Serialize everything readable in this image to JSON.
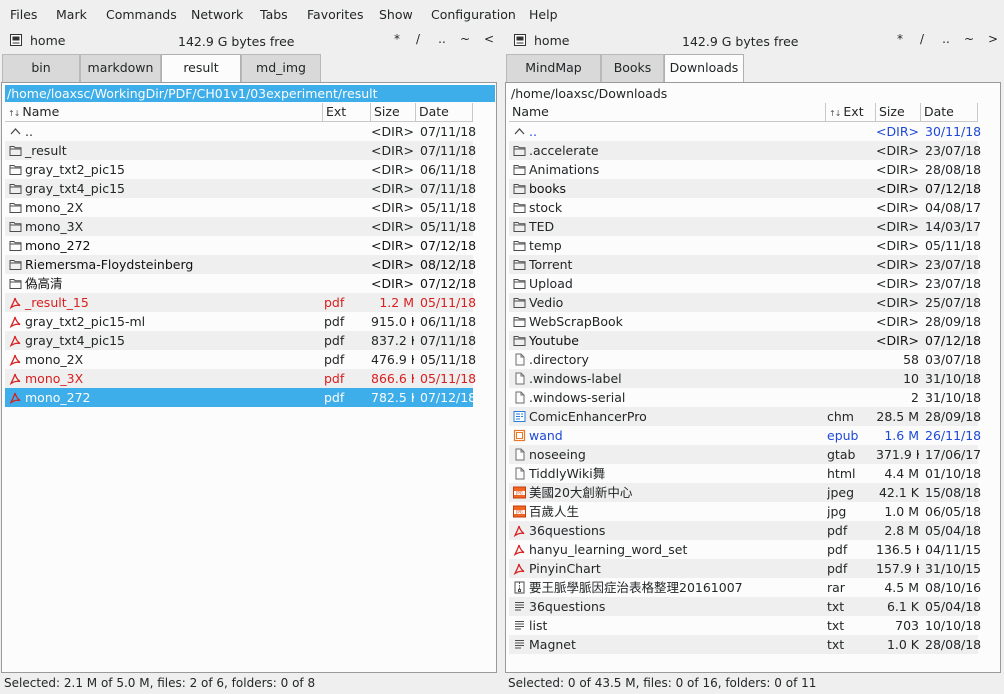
{
  "menu": [
    "Files",
    "Mark",
    "Commands",
    "Network",
    "Tabs",
    "Favorites",
    "Show",
    "Configuration",
    "Help"
  ],
  "left": {
    "drive": "home",
    "free": "142.9 G bytes free",
    "nav": [
      "*",
      "/",
      "..",
      "~",
      "<"
    ],
    "tabs": [
      "bin",
      "markdown",
      "result",
      "md_img"
    ],
    "active_tab": 2,
    "path": "/home/loaxsc/WorkingDir/PDF/CH01v1/03experiment/result",
    "headers": {
      "name": "Name",
      "ext": "Ext",
      "size": "Size",
      "date": "Date"
    },
    "rows": [
      {
        "icon": "up",
        "name": "..",
        "ext": "",
        "size": "<DIR>",
        "date": "07/11/18",
        "style": ""
      },
      {
        "icon": "folder",
        "name": "_result",
        "ext": "",
        "size": "<DIR>",
        "date": "07/11/18",
        "style": ""
      },
      {
        "icon": "folder",
        "name": "gray_txt2_pic15",
        "ext": "",
        "size": "<DIR>",
        "date": "06/11/18",
        "style": ""
      },
      {
        "icon": "folder",
        "name": "gray_txt4_pic15",
        "ext": "",
        "size": "<DIR>",
        "date": "07/11/18",
        "style": ""
      },
      {
        "icon": "folder",
        "name": "mono_2X",
        "ext": "",
        "size": "<DIR>",
        "date": "05/11/18",
        "style": ""
      },
      {
        "icon": "folder",
        "name": "mono_3X",
        "ext": "",
        "size": "<DIR>",
        "date": "05/11/18",
        "style": ""
      },
      {
        "icon": "folder",
        "name": "mono_272",
        "ext": "",
        "size": "<DIR>",
        "date": "07/12/18",
        "style": "bold"
      },
      {
        "icon": "folder",
        "name": "Riemersma-Floydsteinberg",
        "ext": "",
        "size": "<DIR>",
        "date": "08/12/18",
        "style": "bold"
      },
      {
        "icon": "folder",
        "name": "偽高清",
        "ext": "",
        "size": "<DIR>",
        "date": "07/12/18",
        "style": "bold"
      },
      {
        "icon": "pdf",
        "name": "_result_15",
        "ext": "pdf",
        "size": "1.2 M",
        "date": "05/11/18",
        "style": "red"
      },
      {
        "icon": "pdf",
        "name": "gray_txt2_pic15-ml",
        "ext": "pdf",
        "size": "915.0 K",
        "date": "06/11/18",
        "style": ""
      },
      {
        "icon": "pdf",
        "name": "gray_txt4_pic15",
        "ext": "pdf",
        "size": "837.2 K",
        "date": "07/11/18",
        "style": ""
      },
      {
        "icon": "pdf",
        "name": "mono_2X",
        "ext": "pdf",
        "size": "476.9 K",
        "date": "05/11/18",
        "style": ""
      },
      {
        "icon": "pdf",
        "name": "mono_3X",
        "ext": "pdf",
        "size": "866.6 K",
        "date": "05/11/18",
        "style": "red"
      },
      {
        "icon": "pdf",
        "name": "mono_272",
        "ext": "pdf",
        "size": "782.5 K",
        "date": "07/12/18",
        "style": "sel"
      }
    ],
    "status": "Selected: 2.1 M of 5.0 M, files: 2 of 6, folders: 0 of 8"
  },
  "right": {
    "drive": "home",
    "free": "142.9 G bytes free",
    "nav": [
      "*",
      "/",
      "..",
      "~",
      ">"
    ],
    "tabs": [
      "MindMap",
      "Books",
      "Downloads"
    ],
    "active_tab": 2,
    "path": "/home/loaxsc/Downloads",
    "headers": {
      "name": "Name",
      "ext": "Ext",
      "size": "Size",
      "date": "Date"
    },
    "rows": [
      {
        "icon": "up",
        "name": "..",
        "ext": "",
        "size": "<DIR>",
        "date": "30/11/18",
        "style": "blue"
      },
      {
        "icon": "folder",
        "name": ".accelerate",
        "ext": "",
        "size": "<DIR>",
        "date": "23/07/18",
        "style": ""
      },
      {
        "icon": "folder",
        "name": "Animations",
        "ext": "",
        "size": "<DIR>",
        "date": "28/08/18",
        "style": ""
      },
      {
        "icon": "folder",
        "name": "books",
        "ext": "",
        "size": "<DIR>",
        "date": "07/12/18",
        "style": "bold"
      },
      {
        "icon": "folder",
        "name": "stock",
        "ext": "",
        "size": "<DIR>",
        "date": "04/08/17",
        "style": ""
      },
      {
        "icon": "folder",
        "name": "TED",
        "ext": "",
        "size": "<DIR>",
        "date": "14/03/17",
        "style": ""
      },
      {
        "icon": "folder",
        "name": "temp",
        "ext": "",
        "size": "<DIR>",
        "date": "05/11/18",
        "style": ""
      },
      {
        "icon": "folder",
        "name": "Torrent",
        "ext": "",
        "size": "<DIR>",
        "date": "23/07/18",
        "style": ""
      },
      {
        "icon": "folder",
        "name": "Upload",
        "ext": "",
        "size": "<DIR>",
        "date": "23/07/18",
        "style": ""
      },
      {
        "icon": "folder",
        "name": "Vedio",
        "ext": "",
        "size": "<DIR>",
        "date": "25/07/18",
        "style": ""
      },
      {
        "icon": "folder",
        "name": "WebScrapBook",
        "ext": "",
        "size": "<DIR>",
        "date": "28/09/18",
        "style": ""
      },
      {
        "icon": "folder",
        "name": "Youtube",
        "ext": "",
        "size": "<DIR>",
        "date": "07/12/18",
        "style": "bold"
      },
      {
        "icon": "file",
        "name": ".directory",
        "ext": "",
        "size": "58",
        "date": "03/07/18",
        "style": ""
      },
      {
        "icon": "file",
        "name": ".windows-label",
        "ext": "",
        "size": "10",
        "date": "31/10/18",
        "style": ""
      },
      {
        "icon": "file",
        "name": ".windows-serial",
        "ext": "",
        "size": "2",
        "date": "31/10/18",
        "style": ""
      },
      {
        "icon": "chm",
        "name": "ComicEnhancerPro",
        "ext": "chm",
        "size": "28.5 M",
        "date": "28/09/18",
        "style": ""
      },
      {
        "icon": "epub",
        "name": "wand",
        "ext": "epub",
        "size": "1.6 M",
        "date": "26/11/18",
        "style": "blue"
      },
      {
        "icon": "file",
        "name": "noseeing",
        "ext": "gtab",
        "size": "371.9 K",
        "date": "17/06/17",
        "style": ""
      },
      {
        "icon": "file",
        "name": "TiddlyWiki舞",
        "ext": "html",
        "size": "4.4 M",
        "date": "01/10/18",
        "style": ""
      },
      {
        "icon": "jpg",
        "name": "美國20大創新中心",
        "ext": "jpeg",
        "size": "42.1 K",
        "date": "15/08/18",
        "style": ""
      },
      {
        "icon": "jpg",
        "name": "百歲人生",
        "ext": "jpg",
        "size": "1.0 M",
        "date": "06/05/18",
        "style": ""
      },
      {
        "icon": "pdf",
        "name": "36questions",
        "ext": "pdf",
        "size": "2.8 M",
        "date": "05/04/18",
        "style": ""
      },
      {
        "icon": "pdf",
        "name": "hanyu_learning_word_set",
        "ext": "pdf",
        "size": "136.5 K",
        "date": "04/11/15",
        "style": ""
      },
      {
        "icon": "pdf",
        "name": "PinyinChart",
        "ext": "pdf",
        "size": "157.9 K",
        "date": "31/10/15",
        "style": ""
      },
      {
        "icon": "archive",
        "name": "要王脈學脈因症治表格整理20161007",
        "ext": "rar",
        "size": "4.5 M",
        "date": "08/10/16",
        "style": ""
      },
      {
        "icon": "text",
        "name": "36questions",
        "ext": "txt",
        "size": "6.1 K",
        "date": "05/04/18",
        "style": ""
      },
      {
        "icon": "text",
        "name": "list",
        "ext": "txt",
        "size": "703",
        "date": "10/10/18",
        "style": ""
      },
      {
        "icon": "text",
        "name": "Magnet",
        "ext": "txt",
        "size": "1.0 K",
        "date": "28/08/18",
        "style": ""
      }
    ],
    "status": "Selected: 0 of 43.5 M, files: 0 of 16, folders: 0 of 11"
  }
}
